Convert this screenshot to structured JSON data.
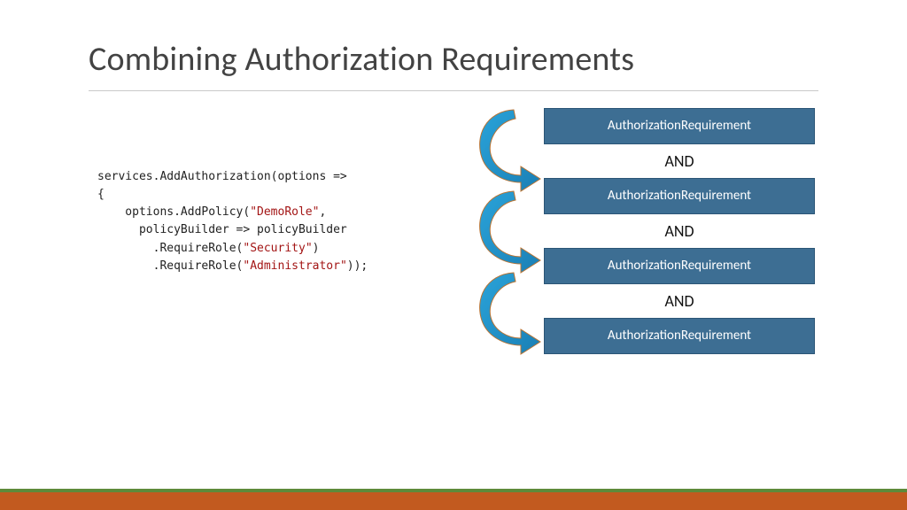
{
  "title": "Combining Authorization Requirements",
  "code": {
    "l1a": "services.AddAuthorization(options =>",
    "l2a": "{",
    "l3a": "    options.AddPolicy(",
    "l3s": "\"DemoRole\"",
    "l3b": ",",
    "l4a": "      policyBuilder => policyBuilder",
    "l5a": "        .RequireRole(",
    "l5s": "\"Security\"",
    "l5b": ")",
    "l6a": "        .RequireRole(",
    "l6s": "\"Administrator\"",
    "l6b": "));"
  },
  "diagram": {
    "box1": "AuthorizationRequirement",
    "and1": "AND",
    "box2": "AuthorizationRequirement",
    "and2": "AND",
    "box3": "AuthorizationRequirement",
    "and3": "AND",
    "box4": "AuthorizationRequirement"
  }
}
